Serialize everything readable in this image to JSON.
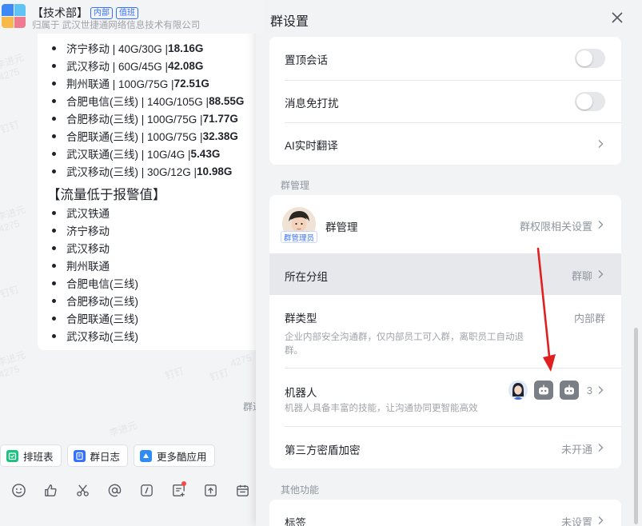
{
  "chat": {
    "group_name": "【技术部】",
    "tag_internal": "内部",
    "tag_duty": "值班",
    "org_line": "归属于 武汉世捷通网络信息技术有限公司",
    "traffic_lines": [
      {
        "text": "济宁移动 | 40G/30G | ",
        "bold": "18.16G"
      },
      {
        "text": "武汉移动 | 60G/45G | ",
        "bold": "42.08G"
      },
      {
        "text": "荆州联通 | 100G/75G | ",
        "bold": "72.51G"
      },
      {
        "text": "合肥电信(三线) | 140G/105G | ",
        "bold": "88.55G"
      },
      {
        "text": "合肥移动(三线) | 100G/75G | ",
        "bold": "71.77G"
      },
      {
        "text": "合肥联通(三线) | 100G/75G | ",
        "bold": "32.38G"
      },
      {
        "text": "武汉联通(三线) | 10G/4G | ",
        "bold": "5.43G"
      },
      {
        "text": "武汉移动(三线) | 30G/12G | ",
        "bold": "10.98G"
      }
    ],
    "alert_heading": "【流量低于报警值】",
    "alert_items": [
      "武汉铁通",
      "济宁移动",
      "武汉移动",
      "荆州联通",
      "合肥电信(三线)",
      "合肥移动(三线)",
      "合肥联通(三线)",
      "武汉移动(三线)"
    ],
    "watermarks": [
      "李进元",
      "4275",
      "钉钉",
      "李进元",
      "4275",
      "钉钉",
      "李进元",
      "4275",
      "钉钉",
      "李进元",
      "4275",
      "钉钉"
    ],
    "cut_text": "群进",
    "apps": [
      {
        "label": "排班表",
        "icon": "schedule-icon",
        "color": "#19c37d"
      },
      {
        "label": "群日志",
        "icon": "log-icon",
        "color": "#3370ff"
      },
      {
        "label": "更多酷应用",
        "icon": "apps-icon",
        "color": "#2f8cf4"
      }
    ],
    "tools": [
      "emoji-icon",
      "thumbs-up-icon",
      "scissors-icon",
      "at-icon",
      "slash-command-icon",
      "sticker-icon",
      "upload-icon",
      "calendar-icon"
    ]
  },
  "panel": {
    "title": "群设置",
    "top_card": {
      "pin_label": "置顶会话",
      "pin_on": false,
      "mute_label": "消息免打扰",
      "mute_on": false,
      "ai_label": "AI实时翻译"
    },
    "section_manage": "群管理",
    "manage_card": {
      "admin_label": "群管理",
      "admin_badge": "群管理员",
      "admin_value": "群权限相关设置",
      "group_label": "所在分组",
      "group_value": "群聊",
      "type_label": "群类型",
      "type_value": "内部群",
      "type_desc": "企业内部安全沟通群，仅内部员工可入群，离职员工自动退群。",
      "bot_label": "机器人",
      "bot_desc": "机器人具备丰富的技能，让沟通协同更智能高效",
      "bot_count": "3",
      "encrypt_label": "第三方密盾加密",
      "encrypt_value": "未开通"
    },
    "section_other": "其他功能",
    "other_card": {
      "tag_label": "标签",
      "tag_value": "未设置"
    },
    "colors": {
      "accent": "#3370ff",
      "annotation_arrow": "#e02020"
    }
  }
}
